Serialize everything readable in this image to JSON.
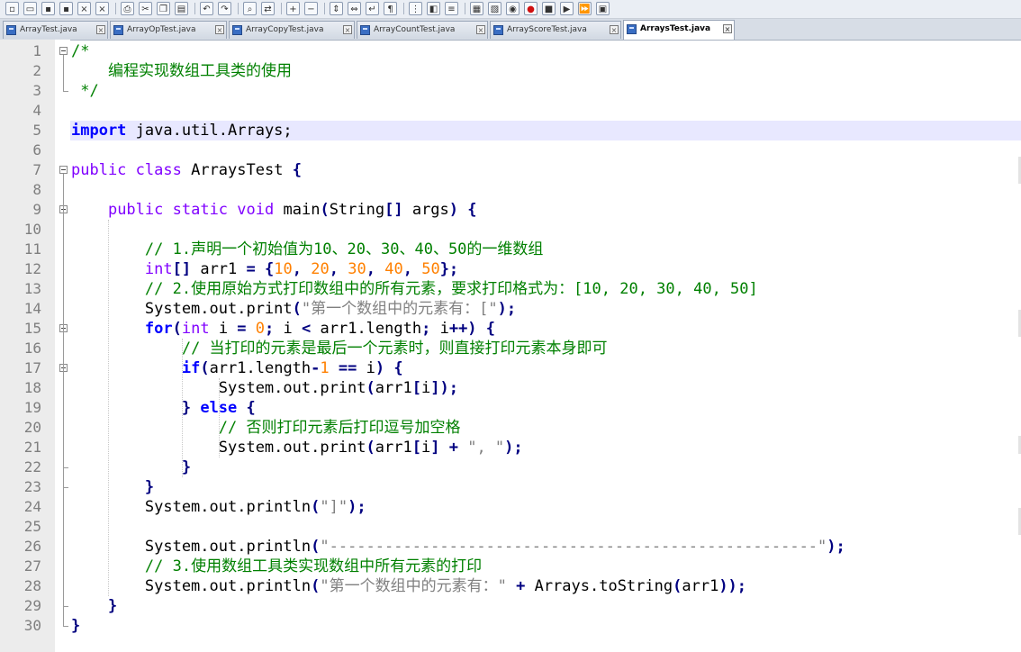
{
  "toolbar": {
    "icons": [
      "new-file-icon",
      "open-file-icon",
      "save-icon",
      "save-all-icon",
      "close-icon",
      "close-all-icon",
      "print-icon",
      "cut-icon",
      "copy-icon",
      "paste-icon",
      "undo-icon",
      "redo-icon",
      "find-icon",
      "replace-icon",
      "zoom-in-icon",
      "zoom-out-icon",
      "sync-scroll-v-icon",
      "sync-scroll-h-icon",
      "word-wrap-icon",
      "show-all-chars-icon",
      "indent-guide-icon",
      "udl-icon",
      "function-list-icon",
      "folder-workspace-icon",
      "doc-map-icon",
      "monitor-icon",
      "record-macro-icon",
      "stop-record-icon",
      "play-macro-icon",
      "run-macro-icon",
      "save-macro-icon"
    ]
  },
  "tabs": [
    {
      "label": "ArrayTest.java",
      "active": false
    },
    {
      "label": "ArrayOpTest.java",
      "active": false
    },
    {
      "label": "ArrayCopyTest.java",
      "active": false
    },
    {
      "label": "ArrayCountTest.java",
      "active": false
    },
    {
      "label": "ArrayScoreTest.java",
      "active": false
    },
    {
      "label": "ArraysTest.java",
      "active": true
    }
  ],
  "editor": {
    "current_line": 5,
    "line_numbers": [
      "1",
      "2",
      "3",
      "4",
      "5",
      "6",
      "7",
      "8",
      "9",
      "10",
      "11",
      "12",
      "13",
      "14",
      "15",
      "16",
      "17",
      "18",
      "19",
      "20",
      "21",
      "22",
      "23",
      "24",
      "25",
      "26",
      "27",
      "28",
      "29",
      "30"
    ],
    "lines": [
      [
        [
          "cmt",
          "/*"
        ]
      ],
      [
        [
          "cmt",
          "    编程实现数组工具类的使用"
        ]
      ],
      [
        [
          "cmt",
          " */"
        ]
      ],
      [],
      [
        [
          "kw",
          "import"
        ],
        [
          "txt",
          " java.util.Arrays;"
        ]
      ],
      [],
      [
        [
          "kw2",
          "public"
        ],
        [
          "txt",
          " "
        ],
        [
          "kw2",
          "class"
        ],
        [
          "txt",
          " ArraysTest "
        ],
        [
          "op",
          "{"
        ]
      ],
      [],
      [
        [
          "txt",
          "    "
        ],
        [
          "kw2",
          "public"
        ],
        [
          "txt",
          " "
        ],
        [
          "kw2",
          "static"
        ],
        [
          "txt",
          " "
        ],
        [
          "kw2",
          "void"
        ],
        [
          "txt",
          " main"
        ],
        [
          "op",
          "("
        ],
        [
          "txt",
          "String"
        ],
        [
          "op",
          "[]"
        ],
        [
          "txt",
          " args"
        ],
        [
          "op",
          ")"
        ],
        [
          "txt",
          " "
        ],
        [
          "op",
          "{"
        ]
      ],
      [],
      [
        [
          "txt",
          "        "
        ],
        [
          "cmt",
          "// 1.声明一个初始值为10、20、30、40、50的一维数组"
        ]
      ],
      [
        [
          "txt",
          "        "
        ],
        [
          "kw2",
          "int"
        ],
        [
          "op",
          "[]"
        ],
        [
          "txt",
          " arr1 "
        ],
        [
          "op",
          "="
        ],
        [
          "txt",
          " "
        ],
        [
          "op",
          "{"
        ],
        [
          "num",
          "10"
        ],
        [
          "op",
          ","
        ],
        [
          "txt",
          " "
        ],
        [
          "num",
          "20"
        ],
        [
          "op",
          ","
        ],
        [
          "txt",
          " "
        ],
        [
          "num",
          "30"
        ],
        [
          "op",
          ","
        ],
        [
          "txt",
          " "
        ],
        [
          "num",
          "40"
        ],
        [
          "op",
          ","
        ],
        [
          "txt",
          " "
        ],
        [
          "num",
          "50"
        ],
        [
          "op",
          "};"
        ]
      ],
      [
        [
          "txt",
          "        "
        ],
        [
          "cmt",
          "// 2.使用原始方式打印数组中的所有元素，要求打印格式为：[10, 20, 30, 40, 50]"
        ]
      ],
      [
        [
          "txt",
          "        System.out.print"
        ],
        [
          "op",
          "("
        ],
        [
          "str",
          "\"第一个数组中的元素有：[\""
        ],
        [
          "op",
          ");"
        ]
      ],
      [
        [
          "txt",
          "        "
        ],
        [
          "kw",
          "for"
        ],
        [
          "op",
          "("
        ],
        [
          "kw2",
          "int"
        ],
        [
          "txt",
          " i "
        ],
        [
          "op",
          "="
        ],
        [
          "txt",
          " "
        ],
        [
          "num",
          "0"
        ],
        [
          "op",
          ";"
        ],
        [
          "txt",
          " i "
        ],
        [
          "op",
          "<"
        ],
        [
          "txt",
          " arr1.length"
        ],
        [
          "op",
          ";"
        ],
        [
          "txt",
          " i"
        ],
        [
          "op",
          "++)"
        ],
        [
          "txt",
          " "
        ],
        [
          "op",
          "{"
        ]
      ],
      [
        [
          "txt",
          "            "
        ],
        [
          "cmt",
          "// 当打印的元素是最后一个元素时，则直接打印元素本身即可"
        ]
      ],
      [
        [
          "txt",
          "            "
        ],
        [
          "kw",
          "if"
        ],
        [
          "op",
          "("
        ],
        [
          "txt",
          "arr1.length"
        ],
        [
          "op",
          "-"
        ],
        [
          "num",
          "1"
        ],
        [
          "txt",
          " "
        ],
        [
          "op",
          "=="
        ],
        [
          "txt",
          " i"
        ],
        [
          "op",
          ")"
        ],
        [
          "txt",
          " "
        ],
        [
          "op",
          "{"
        ]
      ],
      [
        [
          "txt",
          "                System.out.print"
        ],
        [
          "op",
          "("
        ],
        [
          "txt",
          "arr1"
        ],
        [
          "op",
          "["
        ],
        [
          "txt",
          "i"
        ],
        [
          "op",
          "]);"
        ]
      ],
      [
        [
          "txt",
          "            "
        ],
        [
          "op",
          "}"
        ],
        [
          "txt",
          " "
        ],
        [
          "kw",
          "else"
        ],
        [
          "txt",
          " "
        ],
        [
          "op",
          "{"
        ]
      ],
      [
        [
          "txt",
          "                "
        ],
        [
          "cmt",
          "// 否则打印元素后打印逗号加空格"
        ]
      ],
      [
        [
          "txt",
          "                System.out.print"
        ],
        [
          "op",
          "("
        ],
        [
          "txt",
          "arr1"
        ],
        [
          "op",
          "["
        ],
        [
          "txt",
          "i"
        ],
        [
          "op",
          "]"
        ],
        [
          "txt",
          " "
        ],
        [
          "op",
          "+"
        ],
        [
          "txt",
          " "
        ],
        [
          "str",
          "\", \""
        ],
        [
          "op",
          ");"
        ]
      ],
      [
        [
          "txt",
          "            "
        ],
        [
          "op",
          "}"
        ]
      ],
      [
        [
          "txt",
          "        "
        ],
        [
          "op",
          "}"
        ]
      ],
      [
        [
          "txt",
          "        System.out.println"
        ],
        [
          "op",
          "("
        ],
        [
          "str",
          "\"]\""
        ],
        [
          "op",
          ");"
        ]
      ],
      [],
      [
        [
          "txt",
          "        System.out.println"
        ],
        [
          "op",
          "("
        ],
        [
          "str",
          "\"-----------------------------------------------------\""
        ],
        [
          "op",
          ");"
        ]
      ],
      [
        [
          "txt",
          "        "
        ],
        [
          "cmt",
          "// 3.使用数组工具类实现数组中所有元素的打印"
        ]
      ],
      [
        [
          "txt",
          "        System.out.println"
        ],
        [
          "op",
          "("
        ],
        [
          "str",
          "\"第一个数组中的元素有：\""
        ],
        [
          "txt",
          " "
        ],
        [
          "op",
          "+"
        ],
        [
          "txt",
          " Arrays.toString"
        ],
        [
          "op",
          "("
        ],
        [
          "txt",
          "arr1"
        ],
        [
          "op",
          "));"
        ]
      ],
      [
        [
          "txt",
          "    "
        ],
        [
          "op",
          "}"
        ]
      ],
      [
        [
          "op",
          "}"
        ]
      ]
    ]
  }
}
